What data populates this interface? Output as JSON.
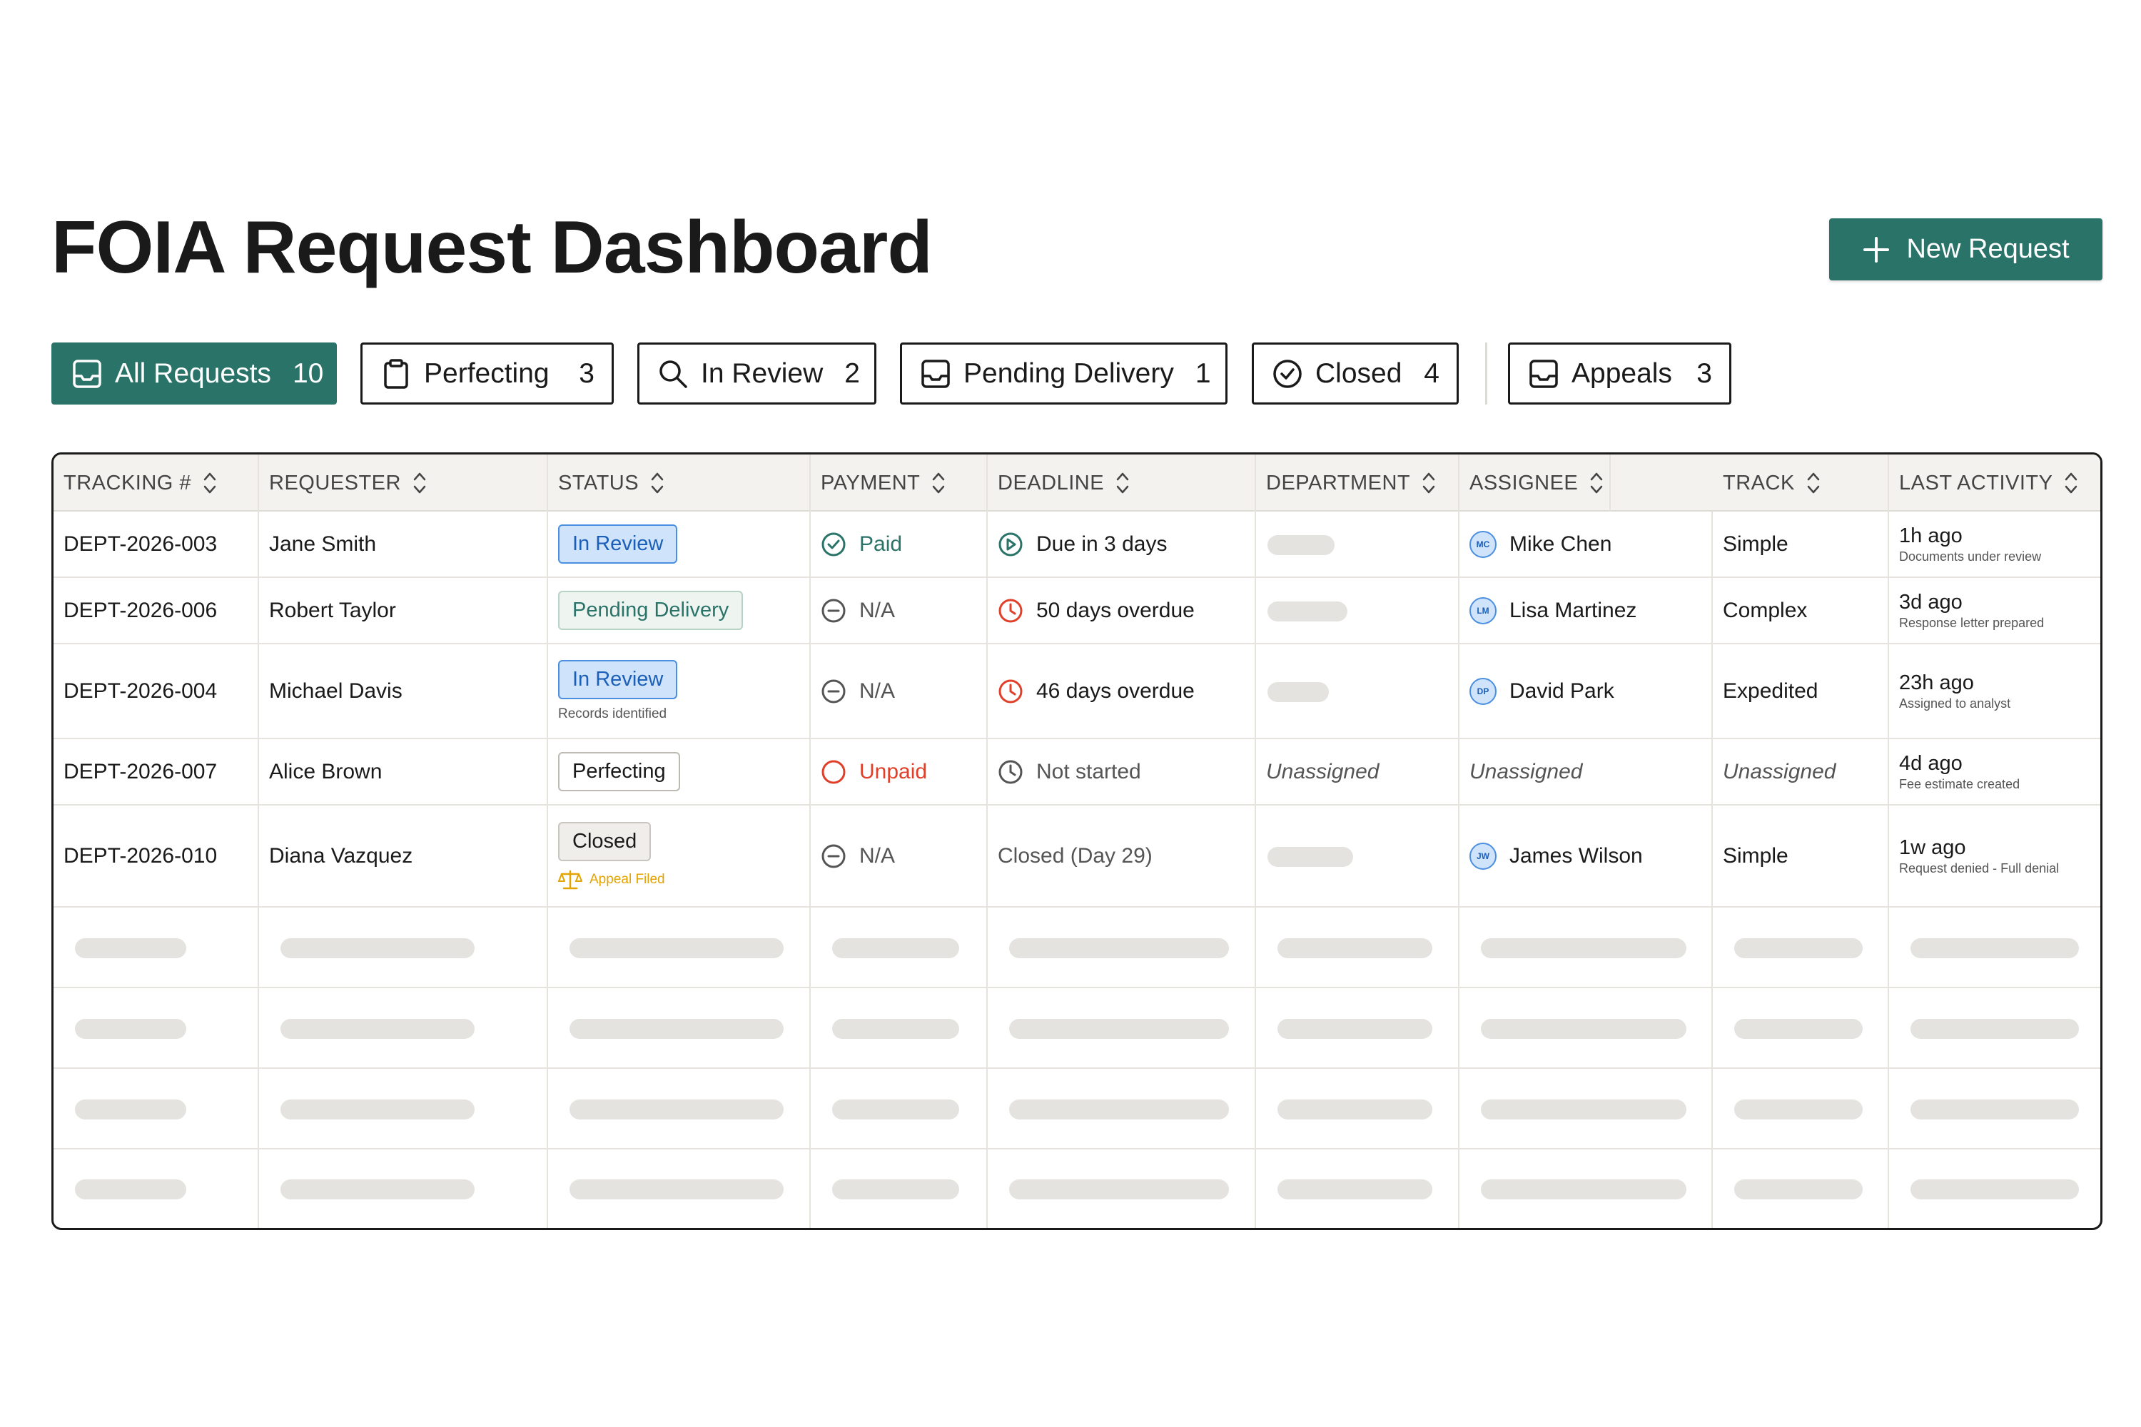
{
  "page": {
    "title": "FOIA Request Dashboard",
    "new_request_label": "New Request"
  },
  "tabs": [
    {
      "label": "All Requests",
      "count": "10",
      "icon": "inbox-icon",
      "active": true
    },
    {
      "label": "Perfecting",
      "count": "3",
      "icon": "clipboard-icon",
      "active": false
    },
    {
      "label": "In Review",
      "count": "2",
      "icon": "search-icon",
      "active": false
    },
    {
      "label": "Pending Delivery",
      "count": "1",
      "icon": "inbox-icon",
      "active": false
    },
    {
      "label": "Closed",
      "count": "4",
      "icon": "check-circle-icon",
      "active": false
    },
    {
      "label": "Appeals",
      "count": "3",
      "icon": "inbox-icon",
      "active": false
    }
  ],
  "table": {
    "columns": [
      "TRACKING #",
      "REQUESTER",
      "STATUS",
      "PAYMENT",
      "DEADLINE",
      "DEPARTMENT",
      "ASSIGNEE",
      "TRACK",
      "LAST ACTIVITY"
    ],
    "rows": [
      {
        "tracking": "DEPT-2026-003",
        "requester": "Jane Smith",
        "status": "In Review",
        "status_note": "",
        "appeal_note": "",
        "payment": "Paid",
        "deadline": "Due in 3 days",
        "department": "",
        "assignee_initials": "MC",
        "assignee": "Mike Chen",
        "track": "Simple",
        "activity": "1h ago",
        "activity_note": "Documents under review"
      },
      {
        "tracking": "DEPT-2026-006",
        "requester": "Robert Taylor",
        "status": "Pending Delivery",
        "status_note": "",
        "appeal_note": "",
        "payment": "N/A",
        "deadline": "50 days overdue",
        "department": "",
        "assignee_initials": "LM",
        "assignee": "Lisa Martinez",
        "track": "Complex",
        "activity": "3d ago",
        "activity_note": "Response letter prepared"
      },
      {
        "tracking": "DEPT-2026-004",
        "requester": "Michael Davis",
        "status": "In Review",
        "status_note": "Records identified",
        "appeal_note": "",
        "payment": "N/A",
        "deadline": "46 days overdue",
        "department": "",
        "assignee_initials": "DP",
        "assignee": "David Park",
        "track": "Expedited",
        "activity": "23h ago",
        "activity_note": "Assigned to analyst"
      },
      {
        "tracking": "DEPT-2026-007",
        "requester": "Alice Brown",
        "status": "Perfecting",
        "status_note": "",
        "appeal_note": "",
        "payment": "Unpaid",
        "deadline": "Not started",
        "department": "Unassigned",
        "assignee_initials": "",
        "assignee": "Unassigned",
        "track": "Unassigned",
        "activity": "4d ago",
        "activity_note": "Fee estimate created"
      },
      {
        "tracking": "DEPT-2026-010",
        "requester": "Diana Vazquez",
        "status": "Closed",
        "status_note": "",
        "appeal_note": "Appeal Filed",
        "payment": "N/A",
        "deadline": "Closed (Day 29)",
        "department": "",
        "assignee_initials": "JW",
        "assignee": "James Wilson",
        "track": "Simple",
        "activity": "1w ago",
        "activity_note": "Request denied - Full denial"
      }
    ]
  },
  "colors": {
    "accent": "#2a7369",
    "review_blue": "#4a8fe0",
    "overdue_red": "#e0402a",
    "appeal_yellow": "#e3a300"
  }
}
